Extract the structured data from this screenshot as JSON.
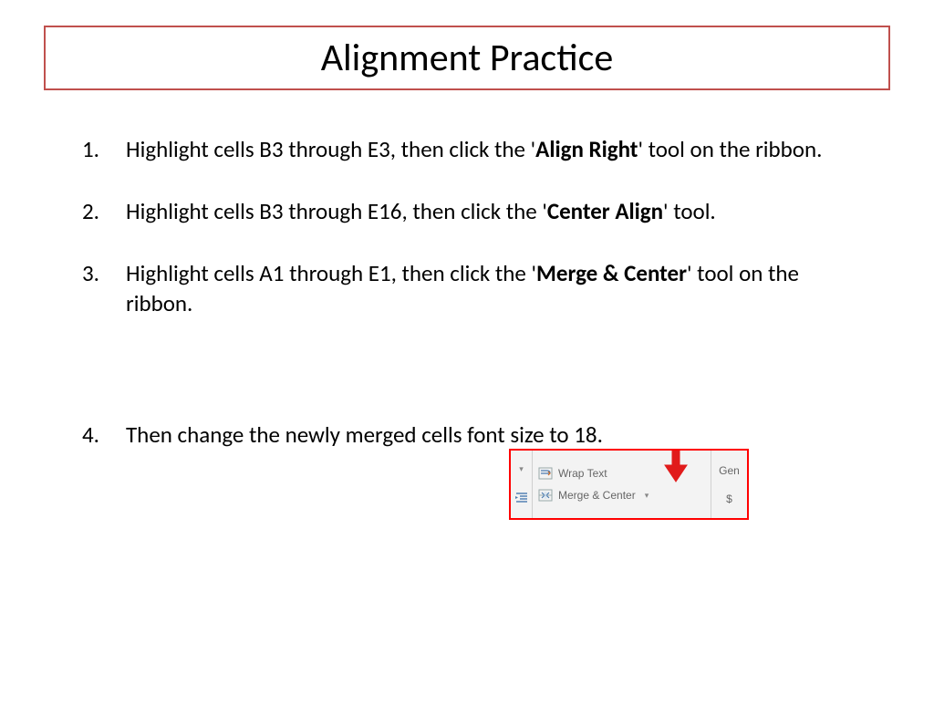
{
  "title": "Alignment Practice",
  "steps": [
    {
      "num": "1.",
      "parts": [
        "Highlight cells B3 through E3, then click the '",
        "Align Right",
        "' tool on the ribbon."
      ]
    },
    {
      "num": "2.",
      "parts": [
        "Highlight cells B3 through E16, then click the '",
        "Center Align",
        "' tool."
      ]
    },
    {
      "num": "3.",
      "parts": [
        "Highlight cells A1 through E1, then click the '",
        "Merge & Center",
        "' tool on the ribbon."
      ]
    },
    {
      "num": "4.",
      "parts": [
        "Then change the newly merged cells font size to 18."
      ]
    }
  ],
  "ribbon": {
    "wrap_label": "Wrap Text",
    "merge_label": "Merge & Center",
    "gen_label": "Gen",
    "dollar_label": "$"
  }
}
